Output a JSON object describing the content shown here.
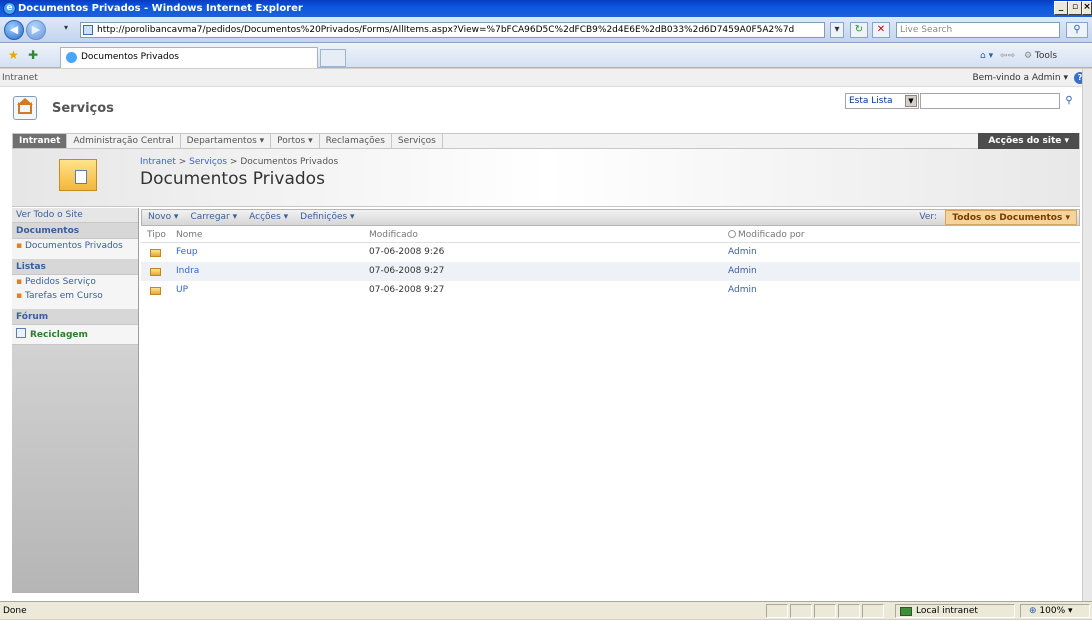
{
  "window": {
    "title": "Documentos Privados - Windows Internet Explorer"
  },
  "browser": {
    "url": "http://porolibancavma7/pedidos/Documentos%20Privados/Forms/AllItems.aspx?View=%7bFCA96D5C%2dFCB9%2d4E6E%2dB033%2d6D7459A0F5A2%7d",
    "search_placeholder": "Live Search",
    "tab_title": "Documentos Privados",
    "tools_label": "Tools"
  },
  "sharepoint": {
    "top_label": "Intranet",
    "welcome": "Bem-vindo a Admin ▾",
    "site_title": "Serviços",
    "search_scope": "Esta Lista",
    "nav_tabs": [
      "Intranet",
      "Administração Central",
      "Departamentos ▾",
      "Portos ▾",
      "Reclamações",
      "Serviços"
    ],
    "site_actions": "Acções do site ▾",
    "breadcrumb": {
      "b1": "Intranet",
      "sep": " > ",
      "b2": "Serviços",
      "b3": "Documentos Privados"
    },
    "page_title": "Documentos Privados"
  },
  "leftnav": {
    "view_all": "Ver Todo o Site",
    "documents_header": "Documentos",
    "doc_item": "Documentos Privados",
    "lists_header": "Listas",
    "list_item_1": "Pedidos Serviço",
    "list_item_2": "Tarefas em Curso",
    "forum_header": "Fórum",
    "recycle": "Reciclagem"
  },
  "toolbar": {
    "new": "Novo ▾",
    "upload": "Carregar ▾",
    "actions": "Acções ▾",
    "settings": "Definições ▾",
    "view_label": "Ver:",
    "view_value": "Todos os Documentos ▾"
  },
  "list": {
    "columns": {
      "type": "Tipo",
      "name": "Nome",
      "modified": "Modificado",
      "modified_by": "Modificado por"
    },
    "rows": [
      {
        "name": "Feup",
        "modified": "07-06-2008 9:26",
        "modified_by": "Admin"
      },
      {
        "name": "Indra",
        "modified": "07-06-2008 9:27",
        "modified_by": "Admin"
      },
      {
        "name": "UP",
        "modified": "07-06-2008 9:27",
        "modified_by": "Admin"
      }
    ]
  },
  "status": {
    "text": "Done",
    "zone": "Local intranet",
    "zoom": "100%"
  },
  "colors": {
    "titlebar": "#0a56e0",
    "site_actions": "#4d4d4d",
    "view_selector": "#f5d49c",
    "link": "#3366cc"
  }
}
